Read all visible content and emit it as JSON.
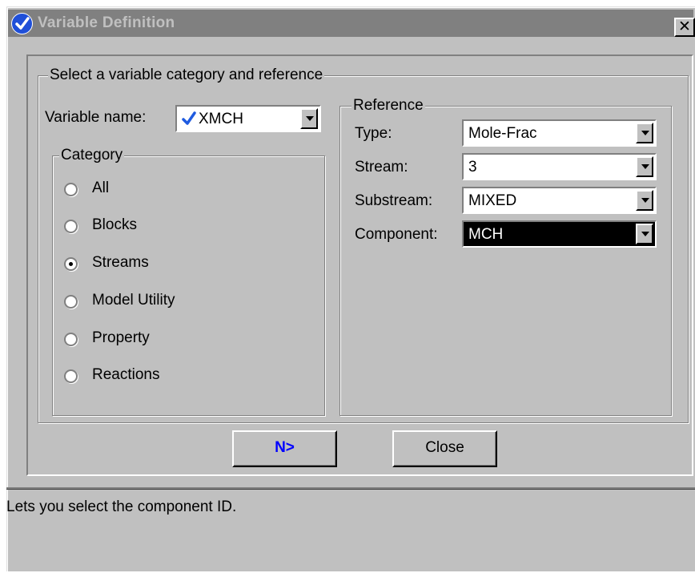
{
  "window": {
    "title": "Variable Definition",
    "close_glyph": "✕",
    "icon": "checkmark-icon"
  },
  "main_group": {
    "legend": "Select a variable category and reference"
  },
  "variable": {
    "label": "Variable name:",
    "value": "XMCH",
    "icon": "checkmark-icon",
    "check_color": "#1f5be0"
  },
  "category": {
    "legend": "Category",
    "options": [
      "All",
      "Blocks",
      "Streams",
      "Model Utility",
      "Property",
      "Reactions"
    ],
    "selected": "Streams"
  },
  "reference": {
    "legend": "Reference",
    "fields": [
      {
        "label": "Type:",
        "value": "Mole-Frac"
      },
      {
        "label": "Stream:",
        "value": "3"
      },
      {
        "label": "Substream:",
        "value": "MIXED"
      },
      {
        "label": "Component:",
        "value": "MCH"
      }
    ],
    "focused_field": "Component:"
  },
  "buttons": {
    "next_label": "N>",
    "next_color": "#0000ff",
    "close_label": "Close"
  },
  "status": {
    "text": "Lets you select the component ID."
  }
}
